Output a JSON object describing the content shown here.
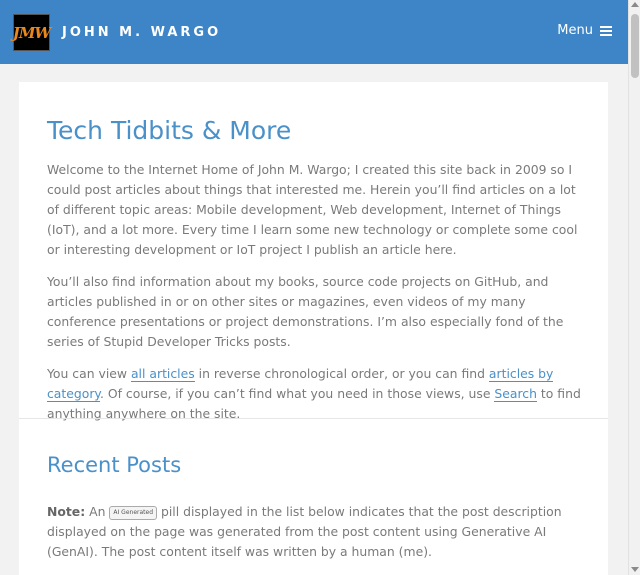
{
  "header": {
    "logo_text": "JMW",
    "site_title": "JOHN M. WARGO",
    "menu_label": "Menu"
  },
  "intro": {
    "title": "Tech Tidbits & More",
    "p1": "Welcome to the Internet Home of John M. Wargo; I created this site back in 2009 so I could post articles about things that interested me. Herein you’ll find articles on a lot of different topic areas: Mobile development, Web development, Internet of Things (IoT), and a lot more. Every time I learn some new technology or complete some cool or interesting development or IoT project I publish an article here.",
    "p2": "You’ll also find information about my books, source code projects on GitHub, and articles published in or on other sites or magazines, even videos of my many conference presentations or project demonstrations. I’m also especially fond of the series of Stupid Developer Tricks posts.",
    "p3_before": "You can view ",
    "p3_link1": "all articles",
    "p3_mid1": " in reverse chronological order, or you can find ",
    "p3_link2": "articles by category",
    "p3_mid2": ". Of course, if you can’t find what you need in those views, use ",
    "p3_link3": "Search",
    "p3_after": " to find anything anywhere on the site."
  },
  "recent": {
    "title": "Recent Posts",
    "note_label": "Note:",
    "note_before": " An ",
    "pill_label": "AI Generated",
    "note_after": " pill displayed in the list below indicates that the post description displayed on the page was generated from the post content using Generative AI (GenAI). The post content itself was written by a human (me)."
  }
}
